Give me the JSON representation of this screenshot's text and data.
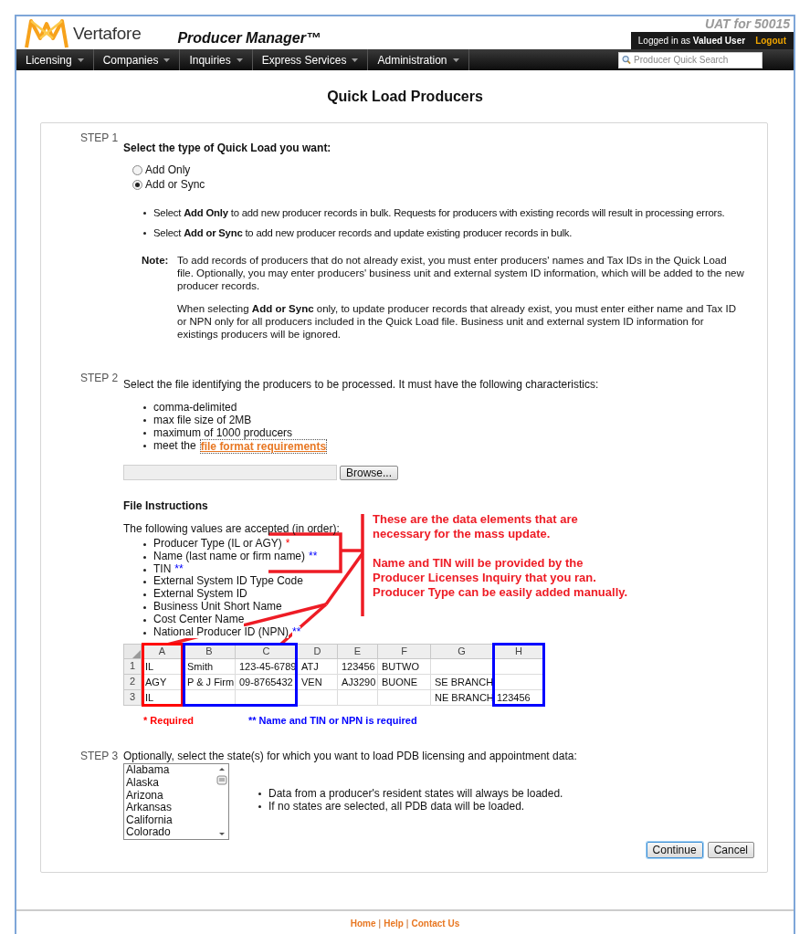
{
  "header": {
    "brand": "Vertafore",
    "app_title": "Producer Manager™",
    "environment": "UAT for 50015",
    "login": {
      "prefix": "Logged in as",
      "user": "Valued User",
      "logout": "Logout"
    },
    "nav": [
      {
        "label": "Licensing"
      },
      {
        "label": "Companies"
      },
      {
        "label": "Inquiries"
      },
      {
        "label": "Express Services"
      },
      {
        "label": "Administration"
      }
    ],
    "search": {
      "placeholder": "Producer Quick Search"
    }
  },
  "page_title": "Quick Load Producers",
  "step1": {
    "label": "STEP 1",
    "heading": "Select the type of Quick Load you want:",
    "options": [
      {
        "label": "Add Only",
        "selected": false
      },
      {
        "label": "Add or Sync",
        "selected": true
      }
    ],
    "bullets": [
      "Select **Add Only** to add new producer records in bulk. Requests for producers with existing records will result in processing errors.",
      "Select **Add or Sync** to add new producer records and update existing producer records in bulk."
    ],
    "note_label": "Note:",
    "note_paragraphs": [
      "To add records of producers that do not already exist, you must enter producers' names and Tax IDs in the Quick Load file. Optionally, you may enter producers' business unit and external system ID information, which will be added to the new producer records.",
      "When selecting **Add or Sync** only, to update producer records that already exist, you must enter either name and Tax ID or NPN only for all producers included in the Quick Load file. Business unit and external system ID information for existings producers will be ignored."
    ]
  },
  "step2": {
    "label": "STEP 2",
    "intro": "Select the file identifying the producers to be processed. It must have the following characteristics:",
    "requirements": [
      {
        "text": "comma-delimited"
      },
      {
        "text": "max file size of 2MB"
      },
      {
        "text": "maximum of 1000 producers"
      },
      {
        "text": "meet the",
        "link": "file format requirements"
      }
    ],
    "browse_button": "Browse...",
    "instructions_title": "File Instructions",
    "accepted_intro": "The following values are accepted (in order):",
    "values": [
      {
        "text": "Producer Type (IL or AGY)",
        "marker": "*",
        "kind": "required"
      },
      {
        "text": "Name (last name or firm name)",
        "marker": "**",
        "kind": "either"
      },
      {
        "text": "TIN",
        "marker": "**",
        "kind": "either"
      },
      {
        "text": "External System ID Type Code"
      },
      {
        "text": "External System ID"
      },
      {
        "text": "Business Unit Short Name"
      },
      {
        "text": "Cost Center Name"
      },
      {
        "text": "National Producer ID (NPN)",
        "marker": "**",
        "kind": "either"
      }
    ],
    "annotation": [
      "These are the data elements that are necessary for the mass update.",
      "Name and TIN will be provided by the Producer Licenses Inquiry that you ran. Producer Type can be easily added manually."
    ],
    "spreadsheet": {
      "columns": [
        "A",
        "B",
        "C",
        "D",
        "E",
        "F",
        "G",
        "H"
      ],
      "rows": [
        {
          "number": "1",
          "cells": [
            "IL",
            "Smith",
            "123-45-6789",
            "ATJ",
            "123456",
            "BUTWO",
            null,
            null
          ]
        },
        {
          "number": "2",
          "cells": [
            "AGY",
            "P & J Firm",
            "09-8765432",
            "VEN",
            "AJ3290",
            "BUONE",
            "SE BRANCH",
            null
          ]
        },
        {
          "number": "3",
          "cells": [
            "IL",
            null,
            null,
            null,
            null,
            null,
            "NE BRANCH",
            "123456"
          ]
        }
      ]
    },
    "legend": [
      {
        "text": "* Required",
        "kind": "required"
      },
      {
        "text": "** Name and TIN or NPN is required",
        "kind": "either"
      }
    ]
  },
  "step3": {
    "label": "STEP 3",
    "intro": "Optionally, select the state(s) for which you want to load PDB licensing and appointment data:",
    "states": [
      "Alabama",
      "Alaska",
      "Arizona",
      "Arkansas",
      "California",
      "Colorado"
    ],
    "notes": [
      "Data from a producer's resident states will always be loaded.",
      "If no states are selected, all PDB data will be loaded."
    ],
    "buttons": [
      {
        "label": "Continue",
        "primary": true
      },
      {
        "label": "Cancel",
        "primary": false
      }
    ]
  },
  "footer": [
    {
      "kind": "link",
      "text": "Home"
    },
    {
      "kind": "separator",
      "text": "|"
    },
    {
      "kind": "link",
      "text": "Help"
    },
    {
      "kind": "separator",
      "text": "|"
    },
    {
      "kind": "link",
      "text": "Contact Us"
    }
  ]
}
